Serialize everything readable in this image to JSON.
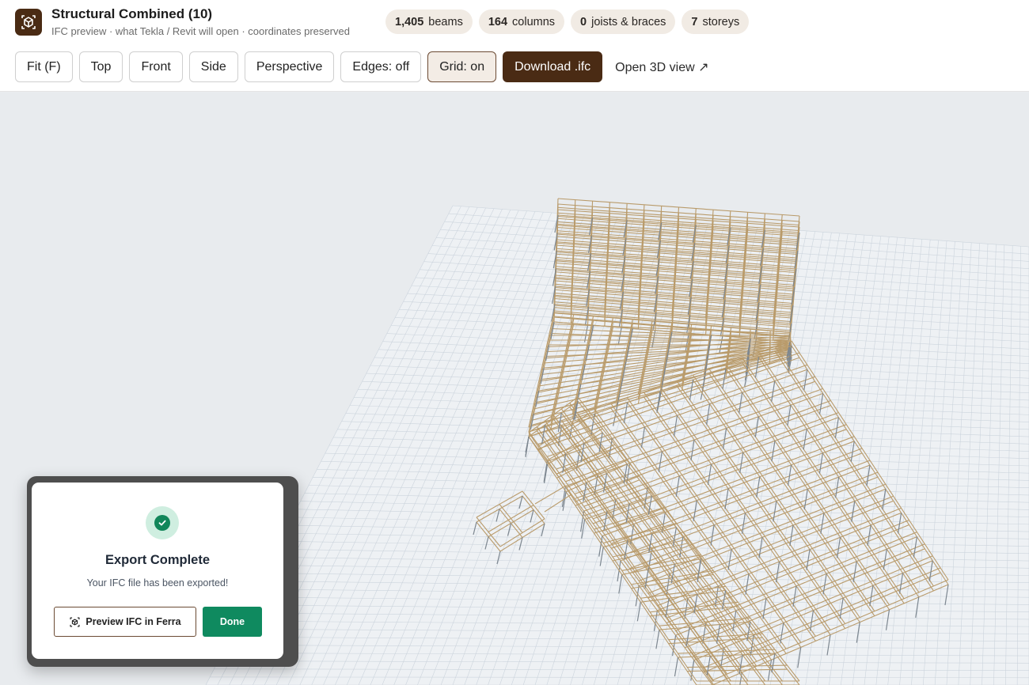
{
  "app": {
    "title": "Structural Combined (10)",
    "subtitle": "IFC preview · what Tekla / Revit will open · coordinates preserved",
    "logo_icon": "box-frame-icon"
  },
  "stats": [
    {
      "value": "1,405",
      "label": "beams"
    },
    {
      "value": "164",
      "label": "columns"
    },
    {
      "value": "0",
      "label": "joists & braces"
    },
    {
      "value": "7",
      "label": "storeys"
    }
  ],
  "toolbar": {
    "fit": "Fit (F)",
    "top": "Top",
    "front": "Front",
    "side": "Side",
    "perspective": "Perspective",
    "edges": "Edges: off",
    "grid": "Grid: on",
    "download": "Download .ifc",
    "open3d": "Open 3D view ↗"
  },
  "dialog": {
    "title": "Export Complete",
    "message": "Your IFC file has been exported!",
    "preview_button": "Preview IFC in Ferra",
    "done_button": "Done"
  },
  "colors": {
    "brand": "#4a2b14",
    "success": "#0f8a5f",
    "beam": "#b99b6b",
    "column": "#7d8790"
  }
}
